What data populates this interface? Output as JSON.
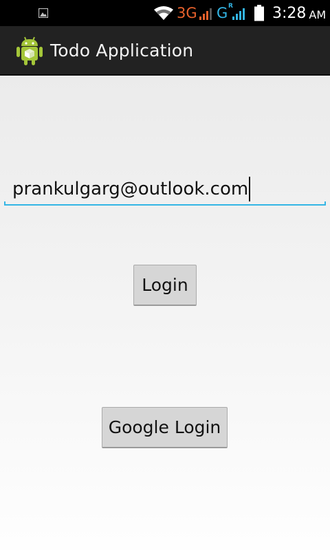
{
  "status_bar": {
    "network_1": "3G",
    "network_2": "G",
    "network_2_superscript": "R",
    "time": "3:28",
    "ampm": "AM",
    "icons": [
      "gallery-icon",
      "wifi-icon",
      "signal-icon",
      "signal-icon",
      "battery-icon"
    ],
    "colors": {
      "network_1": "#e8612c",
      "network_2": "#33b5e5"
    }
  },
  "action_bar": {
    "title": "Todo Application",
    "icon": "android-icon"
  },
  "form": {
    "email_value": "prankulgarg@outlook.com",
    "login_label": "Login",
    "google_login_label": "Google Login",
    "accent_color": "#33b5e5"
  }
}
